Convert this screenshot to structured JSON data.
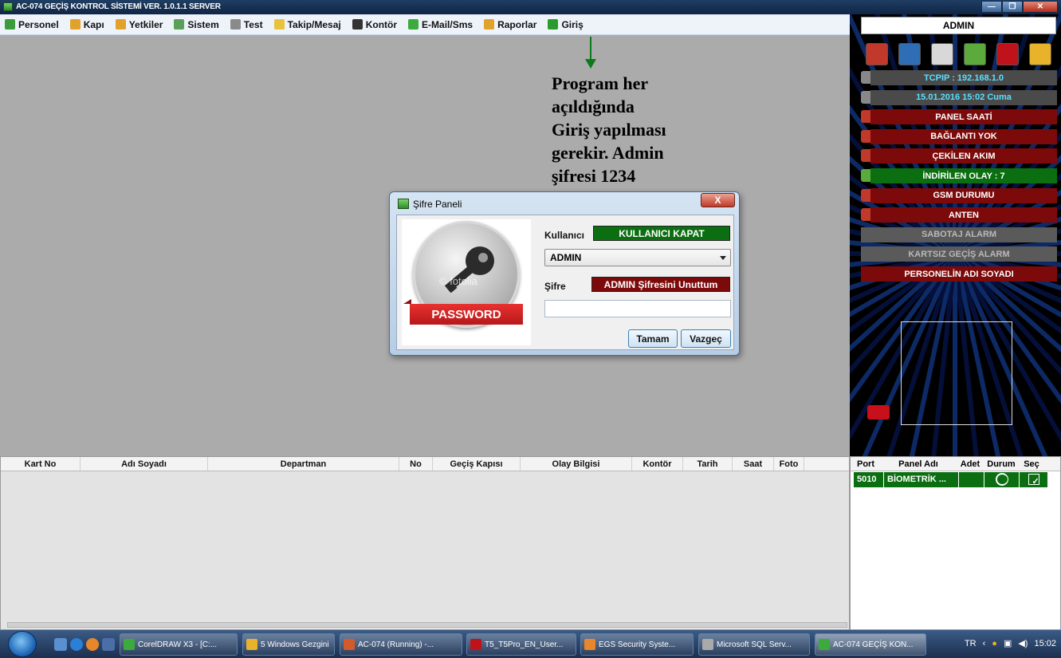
{
  "window": {
    "title": "AC-074 GEÇİŞ KONTROL SİSTEMİ VER. 1.0.1.1 SERVER"
  },
  "menu": [
    {
      "label": "Personel",
      "icon": "person-icon",
      "color": "#3c9c3c"
    },
    {
      "label": "Kapı",
      "icon": "door-icon",
      "color": "#e0a22a"
    },
    {
      "label": "Yetkiler",
      "icon": "key-icon",
      "color": "#e0a22a"
    },
    {
      "label": "Sistem",
      "icon": "gear-icon",
      "color": "#5aa05a"
    },
    {
      "label": "Test",
      "icon": "stethoscope-icon",
      "color": "#8a8a8a"
    },
    {
      "label": "Takip/Mesaj",
      "icon": "folder-icon",
      "color": "#e8c23a"
    },
    {
      "label": "Kontör",
      "icon": "counter-icon",
      "color": "#333333"
    },
    {
      "label": "E-Mail/Sms",
      "icon": "chat-icon",
      "color": "#3caa3c"
    },
    {
      "label": "Raporlar",
      "icon": "report-icon",
      "color": "#e0a22a"
    },
    {
      "label": "Giriş",
      "icon": "login-icon",
      "color": "#2c9a2c"
    }
  ],
  "annotation": {
    "text": "Program her\naçıldığında\nGiriş yapılması\ngerekir. Admin\nşifresi 1234"
  },
  "dialog": {
    "title": "Şifre Paneli",
    "close_label": "X",
    "user_label": "Kullanıcı",
    "user_badge": "KULLANICI KAPAT",
    "selected_user": "ADMIN",
    "password_label": "Şifre",
    "forgot_badge": "ADMIN Şifresini Unuttum",
    "password_value": "",
    "image_text": "PASSWORD",
    "image_watermark": "© fotolia",
    "ok_label": "Tamam",
    "cancel_label": "Vazgeç"
  },
  "grid": {
    "columns": [
      "Kart No",
      "Adı Soyadı",
      "Departman",
      "No",
      "Geçiş Kapısı",
      "Olay Bilgisi",
      "Kontör",
      "Tarih",
      "Saat",
      "Foto"
    ]
  },
  "rpanel": {
    "admin_label": "ADMIN",
    "tool_icons": [
      {
        "name": "fire-icon",
        "color": "#c0392b"
      },
      {
        "name": "door-icon",
        "color": "#2f6db5"
      },
      {
        "name": "pdf-icon",
        "color": "#d8d8d8"
      },
      {
        "name": "download-icon",
        "color": "#5caa3c"
      },
      {
        "name": "arrow-down-icon",
        "color": "#c0121b"
      },
      {
        "name": "exit-icon",
        "color": "#e8b22a"
      }
    ],
    "status": [
      {
        "icon": "network-icon",
        "text": "TCPIP : 192.168.1.0",
        "style": "grey"
      },
      {
        "icon": "alarm-clock-icon",
        "text": "15.01.2016 15:02 Cuma",
        "style": "grey"
      },
      {
        "icon": "clock-icon",
        "text": "PANEL SAATİ",
        "style": "red"
      },
      {
        "icon": "monitor-icon",
        "text": "BAĞLANTI YOK",
        "style": "red"
      },
      {
        "icon": "power-icon",
        "text": "ÇEKİLEN AKIM",
        "style": "red"
      },
      {
        "icon": "event-icon",
        "text": "İNDİRİLEN OLAY : 7",
        "style": "green"
      },
      {
        "icon": "gsm-icon",
        "text": "GSM DURUMU",
        "style": "red"
      },
      {
        "icon": "antenna-icon",
        "text": "ANTEN",
        "style": "red"
      },
      {
        "icon": "",
        "text": "SABOTAJ ALARM",
        "style": "dim"
      },
      {
        "icon": "",
        "text": "KARTSIZ GEÇİŞ ALARM",
        "style": "dim"
      },
      {
        "icon": "",
        "text": "PERSONELİN ADI SOYADI",
        "style": "red"
      }
    ]
  },
  "portgrid": {
    "columns": [
      "Port",
      "Panel Adı",
      "Adet",
      "Durum",
      "Seç"
    ],
    "rows": [
      {
        "port": "5010",
        "panel": "BİOMETRİK ...",
        "adet": "",
        "seç": "✓"
      }
    ]
  },
  "taskbar": {
    "items": [
      {
        "label": "CorelDRAW X3 - [C:...",
        "color": "#3caa3c"
      },
      {
        "label": "5 Windows Gezgini",
        "color": "#e8b22a"
      },
      {
        "label": "AC-074 (Running) -...",
        "color": "#d35a2a"
      },
      {
        "label": "T5_T5Pro_EN_User...",
        "color": "#c0121b"
      },
      {
        "label": "EGS Security Syste...",
        "color": "#e8862a"
      },
      {
        "label": "Microsoft SQL Serv...",
        "color": "#aaaaaa"
      },
      {
        "label": "AC-074 GEÇİŞ KON...",
        "color": "#3caa3c"
      }
    ],
    "lang": "TR",
    "clock": "15:02"
  }
}
